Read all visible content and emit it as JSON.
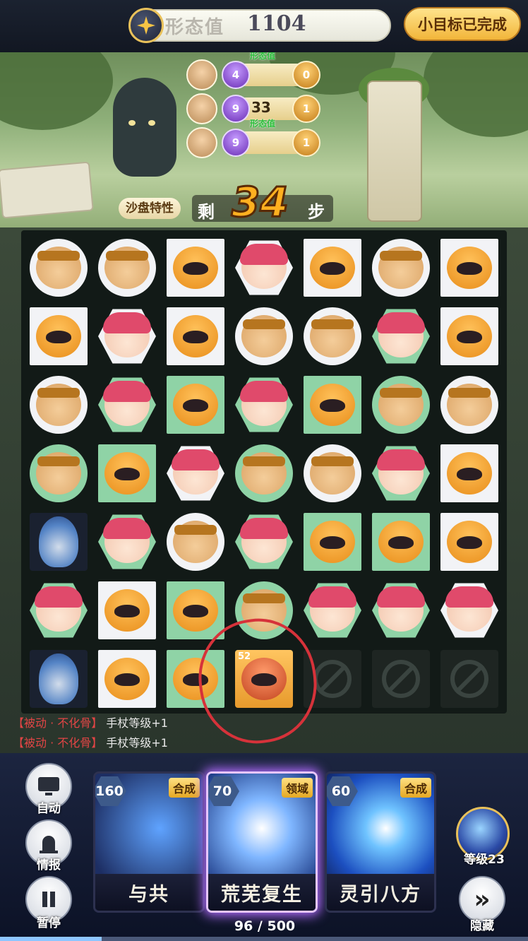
{
  "header": {
    "score_label": "形态值",
    "score_value": "1104",
    "goal_button": "小目标已完成"
  },
  "vs_rows": [
    {
      "left": "4",
      "center": "",
      "right": "0",
      "tag": "形态值"
    },
    {
      "left": "9",
      "center": "33",
      "right": "1",
      "tag": ""
    },
    {
      "left": "9",
      "center": "",
      "right": "1",
      "tag": "形态值"
    }
  ],
  "steps": {
    "sandbox_label": "沙盘特性",
    "prefix": "剩",
    "count": "34",
    "suffix": "步"
  },
  "board": {
    "rows": [
      [
        "white-circle:helm",
        "white-circle:helm",
        "white-sq:mask",
        "white-hex:girl",
        "white-sq:mask",
        "white-circle:helm",
        "white-sq:mask"
      ],
      [
        "white-sq:mask",
        "white-hex:girl",
        "white-sq:mask",
        "white-circle:helm",
        "white-circle:helm",
        "green-hex:girl",
        "white-sq:mask"
      ],
      [
        "white-circle:helm",
        "green-hex:girl",
        "green-sq:mask",
        "green-hex:girl",
        "green-sq:mask",
        "green-circle:helm",
        "white-circle:helm"
      ],
      [
        "green-circle:helm",
        "green-sq:mask",
        "white-hex:girl",
        "green-circle:helm",
        "white-circle:helm",
        "green-hex:girl:selected",
        "white-sq:mask"
      ],
      [
        "dark:flame",
        "green-hex:girl",
        "white-circle:helm",
        "green-hex:girl",
        "green-sq:mask",
        "green-sq:mask",
        "white-sq:mask"
      ],
      [
        "green-hex:girl",
        "white-sq:mask",
        "green-sq:mask",
        "green-circle:helm",
        "green-hex:girl",
        "green-hex:girl",
        "white-hex:girl"
      ],
      [
        "dark:flame",
        "white-sq:mask",
        "green-sq:mask",
        "orange-sq:special",
        "empty:blocked",
        "empty:blocked",
        "empty:blocked"
      ]
    ],
    "special_value": "52"
  },
  "log": [
    {
      "tag": "【被动 · 不化骨】",
      "text": "手杖等级+1"
    },
    {
      "tag": "【被动 · 不化骨】",
      "text": "手杖等级+1"
    }
  ],
  "side_buttons": [
    {
      "label": "自动",
      "icon": "monitor-icon"
    },
    {
      "label": "情报",
      "icon": "siren-icon"
    },
    {
      "label": "暂停",
      "icon": "pause-icon"
    }
  ],
  "cards": [
    {
      "cost": "160",
      "type": "合成",
      "name": "与共",
      "glow": false,
      "color": "#2d4f8f"
    },
    {
      "cost": "70",
      "type": "领域",
      "name": "荒芜复生",
      "glow": true,
      "color": "#3a6cc4"
    },
    {
      "cost": "60",
      "type": "合成",
      "name": "灵引八方",
      "glow": false,
      "color": "#2a62c8"
    }
  ],
  "progress": {
    "current": 96,
    "max": 500,
    "text": "96 / 500"
  },
  "level": {
    "label": "等级23"
  },
  "hide_button": {
    "label": "隐藏"
  },
  "colors": {
    "accent": "#ffb020",
    "goal": "#f2b53a",
    "selection": "#5fe6ff",
    "annotation": "#d6323a"
  }
}
